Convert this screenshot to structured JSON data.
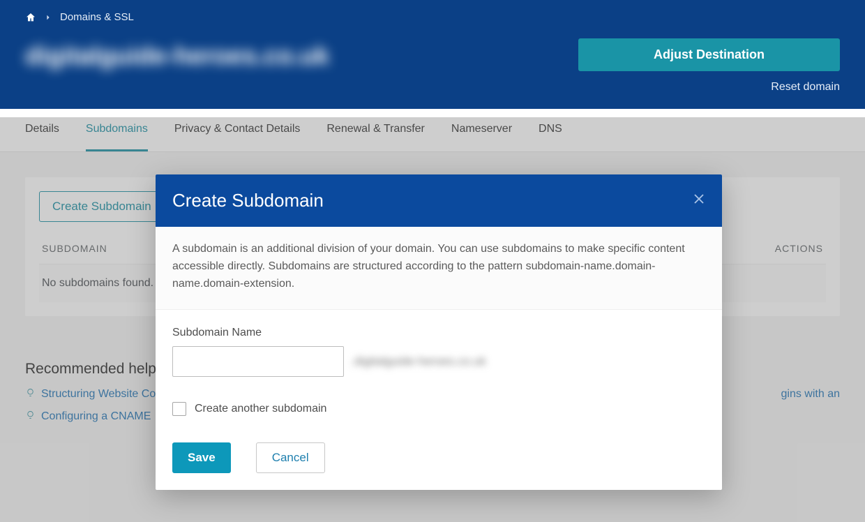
{
  "breadcrumb": {
    "current": "Domains & SSL"
  },
  "header": {
    "domain_title": "digitalguide-heroes.co.uk",
    "adjust_button": "Adjust Destination",
    "reset_link": "Reset domain"
  },
  "tabs": [
    {
      "label": "Details"
    },
    {
      "label": "Subdomains"
    },
    {
      "label": "Privacy & Contact Details"
    },
    {
      "label": "Renewal & Transfer"
    },
    {
      "label": "Nameserver"
    },
    {
      "label": "DNS"
    }
  ],
  "active_tab": 1,
  "card": {
    "create_button": "Create Subdomain"
  },
  "table": {
    "col_subdomain": "SUBDOMAIN",
    "col_actions": "ACTIONS",
    "empty_text": "No subdomains found."
  },
  "help": {
    "title": "Recommended help topics",
    "link1": "Structuring Website Content",
    "link2": "Configuring a CNAME",
    "right_fragment": "gins with an"
  },
  "modal": {
    "title": "Create Subdomain",
    "description": "A subdomain is an additional division of your domain. You can use subdomains to make specific content accessible directly. Subdomains are structured according to the pattern subdomain-name.domain-name.domain-extension.",
    "field_label": "Subdomain Name",
    "domain_suffix": ".digitalguide-heroes.co.uk",
    "checkbox_label": "Create another subdomain",
    "save": "Save",
    "cancel": "Cancel"
  }
}
